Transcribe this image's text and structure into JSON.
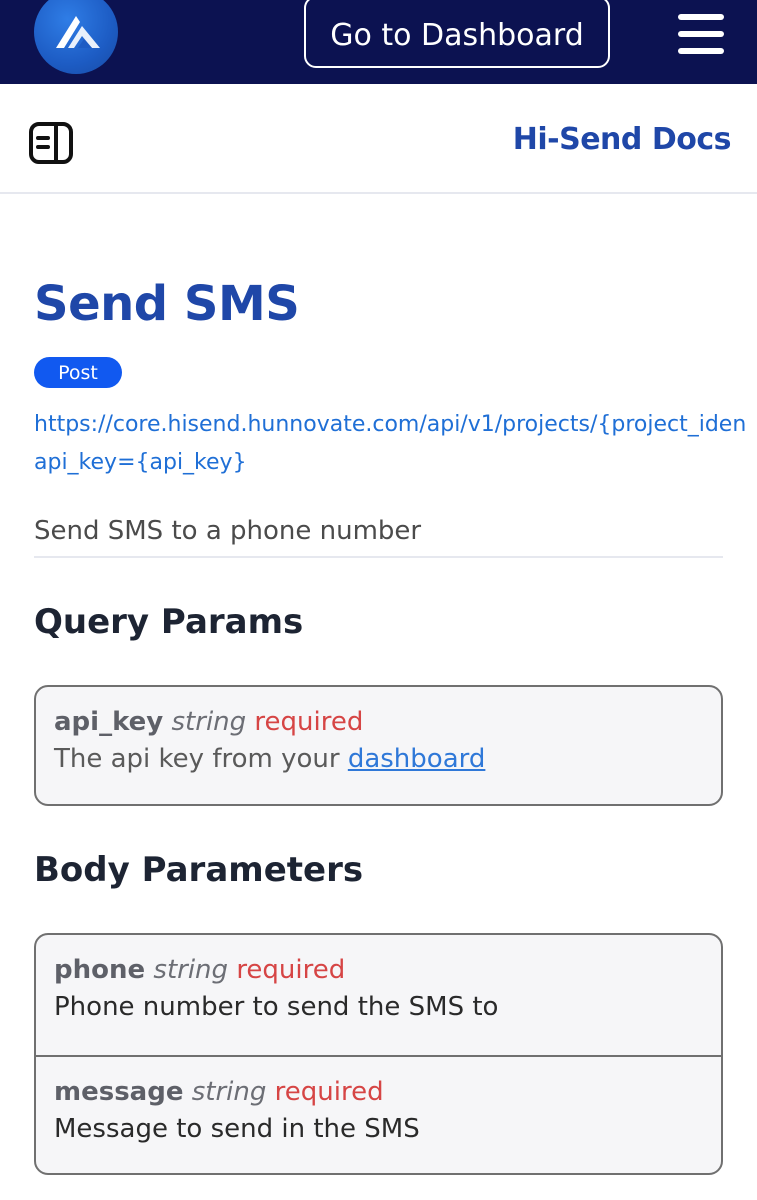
{
  "topbar": {
    "dashboard_label": "Go to Dashboard",
    "bg_color": "#0c1251",
    "logo_icon": "brand-logo-icon",
    "menu_icon": "hamburger-menu-icon"
  },
  "subbar": {
    "sidebar_icon": "sidebar-toggle-icon",
    "docs_title": "Hi-Send Docs"
  },
  "endpoint": {
    "title": "Send SMS",
    "method": "Post",
    "url_line1": "https://core.hisend.hunnovate.com/api/v1/projects/{project_iden",
    "url_line2": "api_key={api_key}",
    "description": "Send SMS to a phone number"
  },
  "query_params": {
    "heading": "Query Params",
    "items": [
      {
        "name": "api_key",
        "type": "string",
        "required": "required",
        "description_prefix": "The api key from your ",
        "link_text": "dashboard"
      }
    ]
  },
  "body_params": {
    "heading": "Body Parameters",
    "items": [
      {
        "name": "phone",
        "type": "string",
        "required": "required",
        "description": "Phone number to send the SMS to"
      },
      {
        "name": "message",
        "type": "string",
        "required": "required",
        "description": "Message to send in the SMS"
      }
    ]
  },
  "colors": {
    "brand_blue": "#1f47a8",
    "badge_blue": "#1159f0",
    "link_blue": "#1f6fd6",
    "required_red": "#d64545"
  }
}
